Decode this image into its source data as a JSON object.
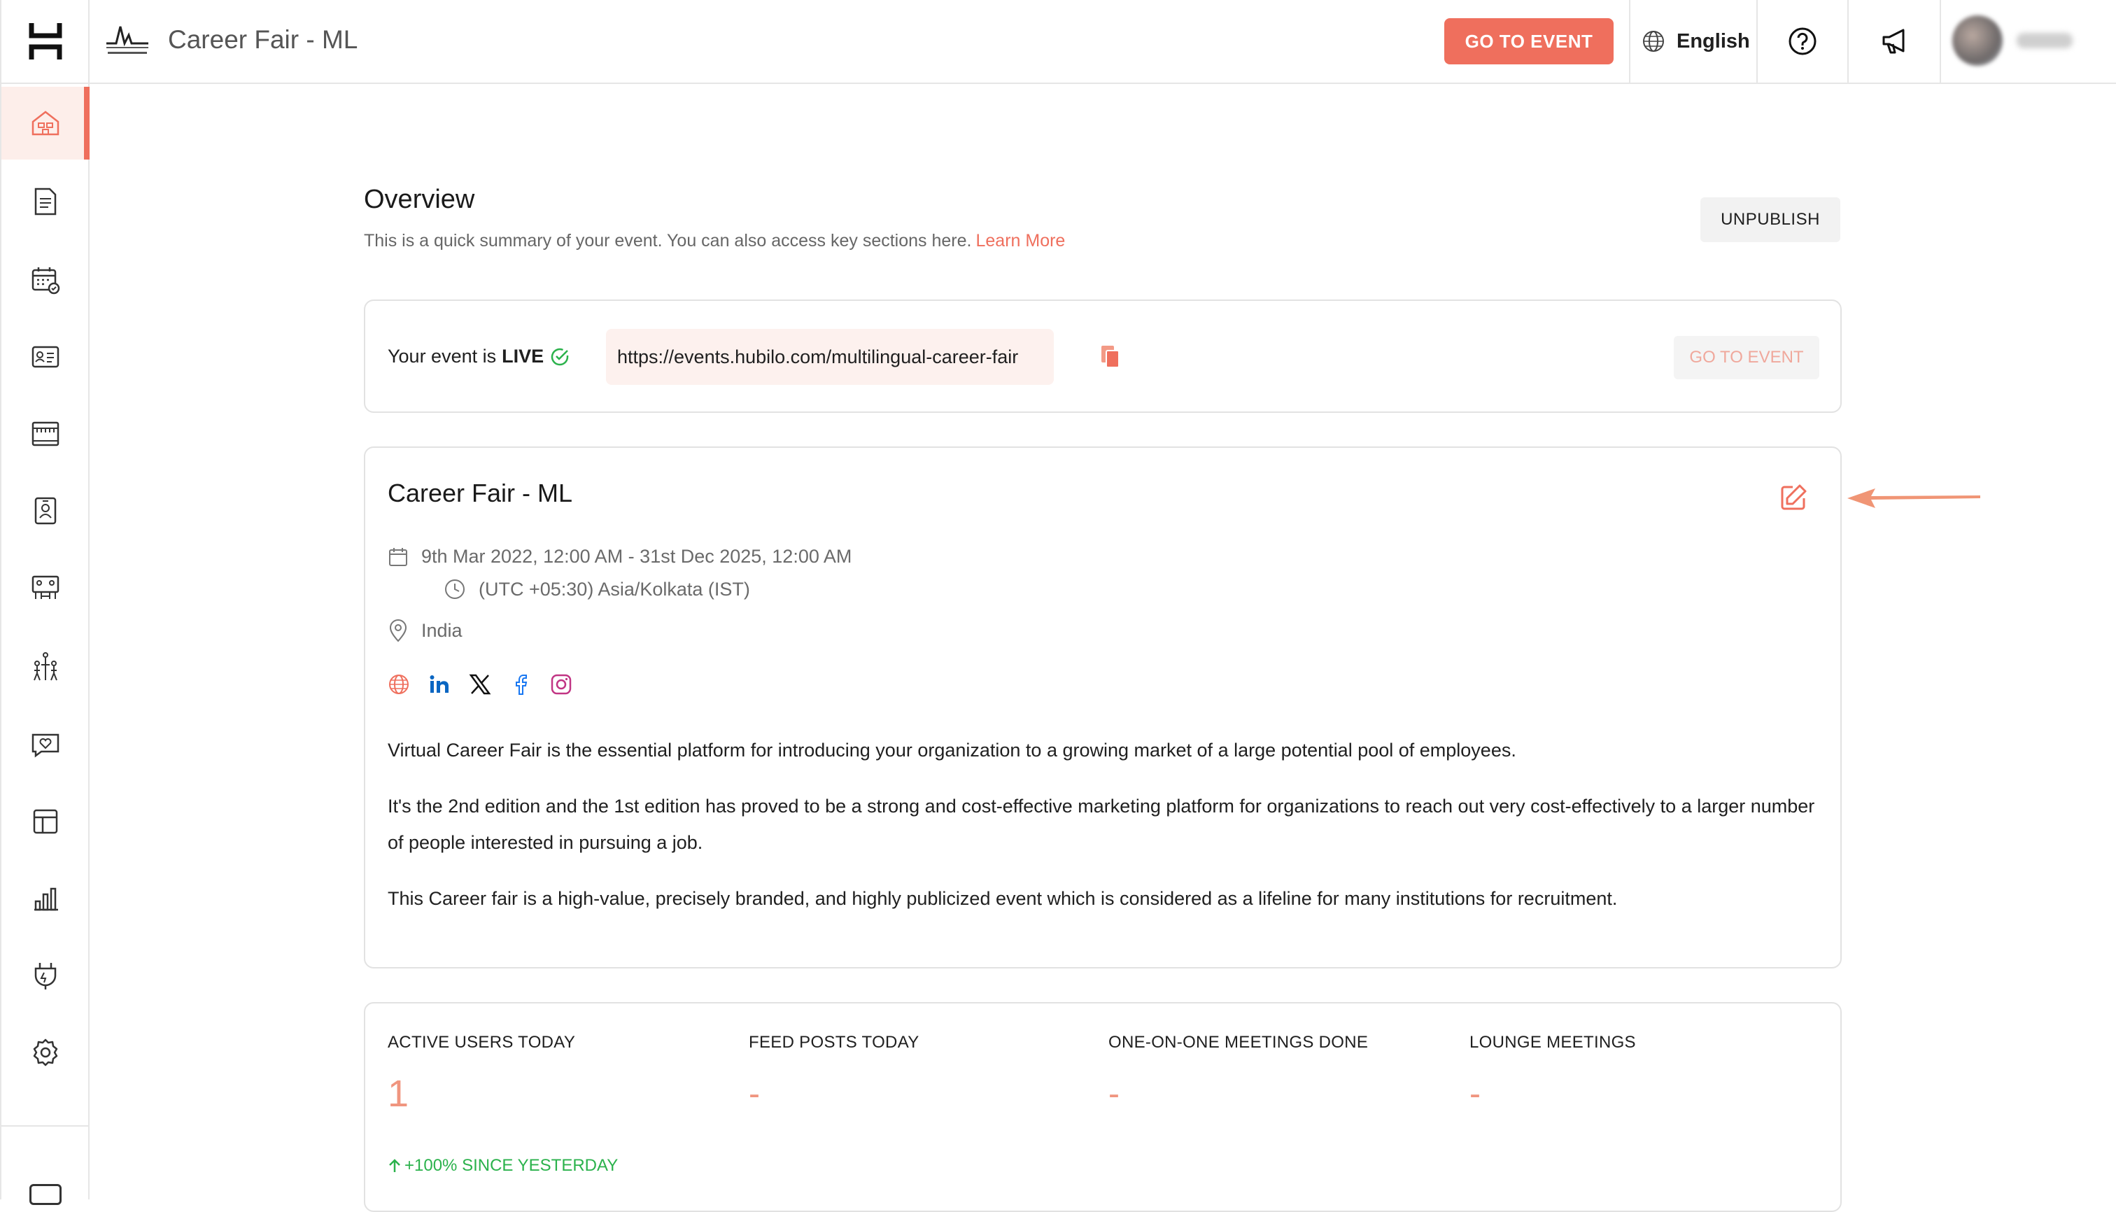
{
  "topbar": {
    "event_title": "Career Fair - ML",
    "go_to_event_label": "GO TO EVENT",
    "language": "English",
    "help_icon": "help-circle-icon",
    "announce_icon": "megaphone-icon",
    "accent_color": "#ef6f5d"
  },
  "sidebar": {
    "items": [
      {
        "icon": "home-icon",
        "active": true
      },
      {
        "icon": "document-icon"
      },
      {
        "icon": "calendar-check-icon"
      },
      {
        "icon": "contact-card-icon"
      },
      {
        "icon": "booth-icon"
      },
      {
        "icon": "badge-icon"
      },
      {
        "icon": "meeting-room-icon"
      },
      {
        "icon": "networking-icon"
      },
      {
        "icon": "engagement-icon"
      },
      {
        "icon": "layout-icon"
      },
      {
        "icon": "analytics-icon"
      },
      {
        "icon": "integrations-icon"
      },
      {
        "icon": "settings-icon"
      }
    ]
  },
  "overview": {
    "title": "Overview",
    "subtitle": "This is a quick summary of your event. You can also access key sections here.",
    "learn_more": "Learn More",
    "unpublish_label": "UNPUBLISH"
  },
  "live_card": {
    "prefix": "Your event is",
    "status": "LIVE",
    "url": "https://events.hubilo.com/multilingual-career-fair",
    "go_to_event_label": "GO TO EVENT"
  },
  "event_info": {
    "title": "Career Fair - ML",
    "date_range": "9th Mar 2022, 12:00 AM - 31st Dec 2025, 12:00 AM",
    "timezone": "(UTC +05:30) Asia/Kolkata (IST)",
    "location": "India",
    "socials": [
      "website-icon",
      "linkedin-icon",
      "x-icon",
      "facebook-icon",
      "instagram-icon"
    ],
    "description": [
      "Virtual Career Fair is the essential platform for introducing your organization to a growing market of a large potential pool of employees.",
      "It's the 2nd edition and the 1st edition has proved to be a strong and cost-effective marketing platform for organizations to reach out very cost-effectively to a larger number of people interested in pursuing a job.",
      "This Career fair is a high-value, precisely branded, and highly publicized event which is considered as a lifeline for many institutions for recruitment."
    ]
  },
  "stats": [
    {
      "label": "ACTIVE USERS TODAY",
      "value": "1"
    },
    {
      "label": "FEED POSTS TODAY",
      "value": "-"
    },
    {
      "label": "ONE-ON-ONE MEETINGS DONE",
      "value": "-"
    },
    {
      "label": "LOUNGE MEETINGS",
      "value": "-"
    }
  ],
  "since_yesterday": "+100% SINCE YESTERDAY"
}
